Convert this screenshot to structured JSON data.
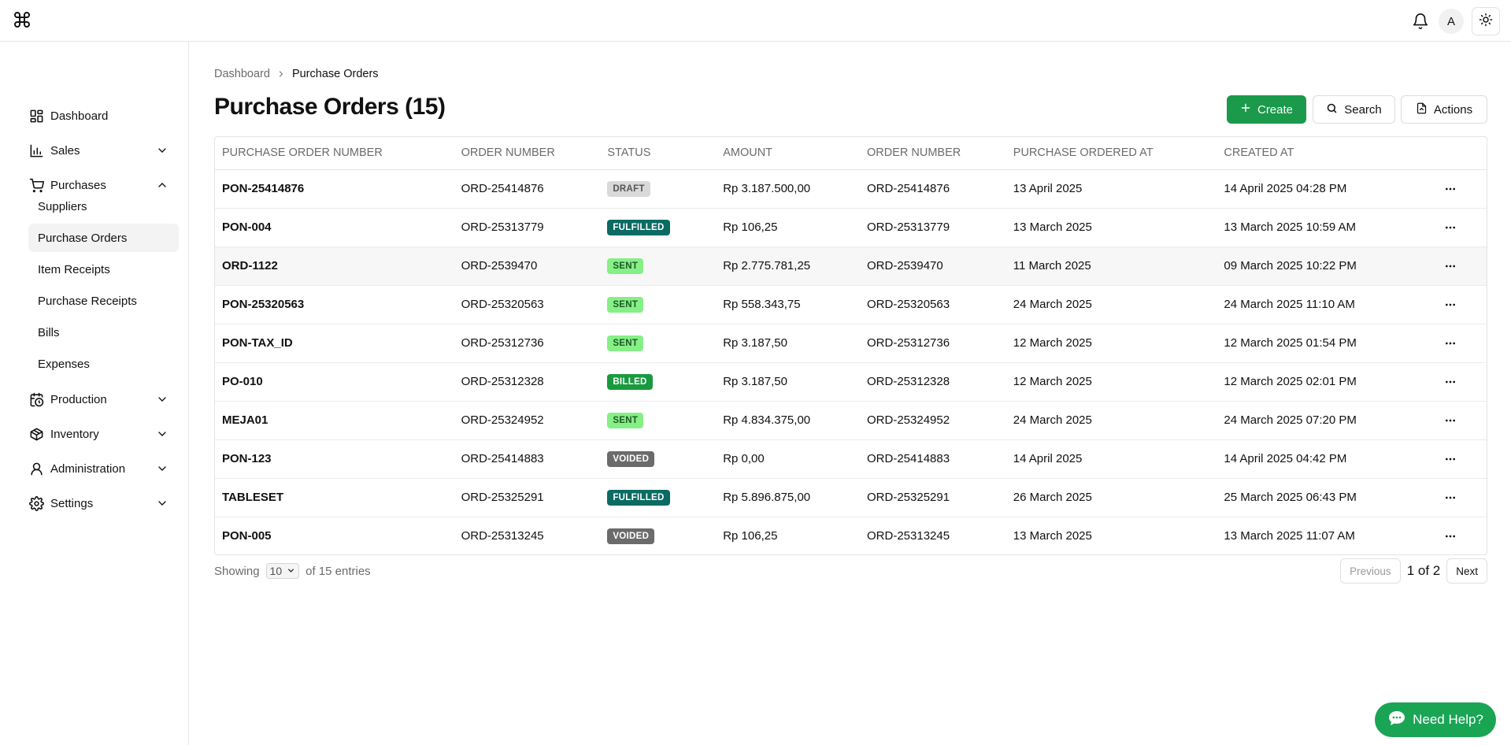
{
  "topbar": {
    "avatar_initial": "A",
    "icons": [
      "command-logo-icon",
      "bell-icon",
      "sun-icon"
    ]
  },
  "sidebar": {
    "items": [
      {
        "label": "Dashboard",
        "icon": "dashboard-icon"
      },
      {
        "label": "Sales",
        "icon": "bar-chart-icon",
        "expanded": false
      },
      {
        "label": "Purchases",
        "icon": "cart-icon",
        "expanded": true
      },
      {
        "label": "Production",
        "icon": "calendar-clock-icon",
        "expanded": false
      },
      {
        "label": "Inventory",
        "icon": "package-icon",
        "expanded": false
      },
      {
        "label": "Administration",
        "icon": "user-icon",
        "expanded": false
      },
      {
        "label": "Settings",
        "icon": "gear-icon",
        "expanded": false
      }
    ],
    "purchases_sub": [
      "Suppliers",
      "Purchase Orders",
      "Item Receipts",
      "Purchase Receipts",
      "Bills",
      "Expenses"
    ],
    "active_sub": "Purchase Orders"
  },
  "breadcrumb": {
    "parent": "Dashboard",
    "current": "Purchase Orders"
  },
  "page": {
    "title": "Purchase Orders (15)"
  },
  "toolbar": {
    "create": "Create",
    "search": "Search",
    "actions": "Actions"
  },
  "table": {
    "headers": [
      "PURCHASE ORDER NUMBER",
      "ORDER NUMBER",
      "STATUS",
      "AMOUNT",
      "ORDER NUMBER",
      "PURCHASE ORDERED AT",
      "CREATED AT"
    ],
    "rows": [
      {
        "po": "PON-25414876",
        "order": "ORD-25414876",
        "status": "DRAFT",
        "amount": "Rp 3.187.500,00",
        "order2": "ORD-25414876",
        "ordered_at": "13 April 2025",
        "created_at": "14 April 2025 04:28 PM"
      },
      {
        "po": "PON-004",
        "order": "ORD-25313779",
        "status": "FULFILLED",
        "amount": "Rp 106,25",
        "order2": "ORD-25313779",
        "ordered_at": "13 March 2025",
        "created_at": "13 March 2025 10:59 AM"
      },
      {
        "po": "ORD-1122",
        "order": "ORD-2539470",
        "status": "SENT",
        "amount": "Rp 2.775.781,25",
        "order2": "ORD-2539470",
        "ordered_at": "11 March 2025",
        "created_at": "09 March 2025 10:22 PM"
      },
      {
        "po": "PON-25320563",
        "order": "ORD-25320563",
        "status": "SENT",
        "amount": "Rp 558.343,75",
        "order2": "ORD-25320563",
        "ordered_at": "24 March 2025",
        "created_at": "24 March 2025 11:10 AM"
      },
      {
        "po": "PON-TAX_ID",
        "order": "ORD-25312736",
        "status": "SENT",
        "amount": "Rp 3.187,50",
        "order2": "ORD-25312736",
        "ordered_at": "12 March 2025",
        "created_at": "12 March 2025 01:54 PM"
      },
      {
        "po": "PO-010",
        "order": "ORD-25312328",
        "status": "BILLED",
        "amount": "Rp 3.187,50",
        "order2": "ORD-25312328",
        "ordered_at": "12 March 2025",
        "created_at": "12 March 2025 02:01 PM"
      },
      {
        "po": "MEJA01",
        "order": "ORD-25324952",
        "status": "SENT",
        "amount": "Rp 4.834.375,00",
        "order2": "ORD-25324952",
        "ordered_at": "24 March 2025",
        "created_at": "24 March 2025 07:20 PM"
      },
      {
        "po": "PON-123",
        "order": "ORD-25414883",
        "status": "VOIDED",
        "amount": "Rp 0,00",
        "order2": "ORD-25414883",
        "ordered_at": "14 April 2025",
        "created_at": "14 April 2025 04:42 PM"
      },
      {
        "po": "TABLESET",
        "order": "ORD-25325291",
        "status": "FULFILLED",
        "amount": "Rp 5.896.875,00",
        "order2": "ORD-25325291",
        "ordered_at": "26 March 2025",
        "created_at": "25 March 2025 06:43 PM"
      },
      {
        "po": "PON-005",
        "order": "ORD-25313245",
        "status": "VOIDED",
        "amount": "Rp 106,25",
        "order2": "ORD-25313245",
        "ordered_at": "13 March 2025",
        "created_at": "13 March 2025 11:07 AM"
      }
    ],
    "hovered_row": 2
  },
  "footer": {
    "showing": "Showing",
    "page_size": "10",
    "of_entries": "of 15 entries",
    "previous": "Previous",
    "page_info": "1 of 2",
    "next": "Next"
  },
  "help": {
    "label": "Need Help?"
  },
  "colors": {
    "accent": "#1a9a4a",
    "help": "#1aa555",
    "fulfilled": "#0b6b63",
    "sent": "#86ef86",
    "voided": "#6b6b6b",
    "draft": "#d9d9d9"
  }
}
